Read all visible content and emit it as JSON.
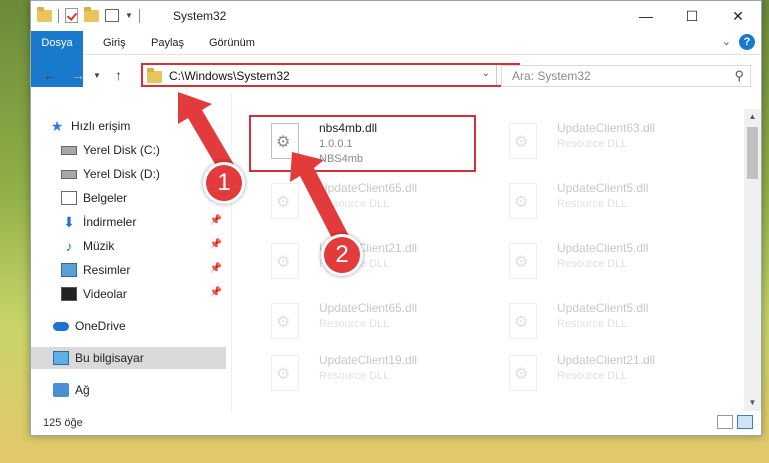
{
  "window": {
    "title": "System32",
    "controls": [
      "—",
      "☐",
      "✕"
    ]
  },
  "ribbon": {
    "tabs": [
      "Dosya",
      "Giriş",
      "Paylaş",
      "Görünüm"
    ]
  },
  "address": {
    "path": "C:\\Windows\\System32",
    "search_placeholder": "Ara: System32"
  },
  "sidebar": {
    "items": [
      {
        "label": "Hızlı erişim"
      },
      {
        "label": "Yerel Disk (C:)"
      },
      {
        "label": "Yerel Disk (D:)"
      },
      {
        "label": "Belgeler"
      },
      {
        "label": "İndirmeler"
      },
      {
        "label": "Müzik"
      },
      {
        "label": "Resimler"
      },
      {
        "label": "Videolar"
      },
      {
        "label": "OneDrive"
      },
      {
        "label": "Bu bilgisayar"
      },
      {
        "label": "Ağ"
      }
    ]
  },
  "files": [
    {
      "name": "nbs4mb.dll",
      "line2": "1.0.0.1",
      "line3": "NBS4mb"
    },
    {
      "name": "UpdateClient63.dll",
      "line2": "Resource DLL"
    },
    {
      "name": "UpdateClient65.dll",
      "line2": "Resource DLL"
    },
    {
      "name": "UpdateClient5.dll",
      "line2": "Resource DLL"
    },
    {
      "name": "UpdateClient21.dll",
      "line2": "Resource DLL"
    },
    {
      "name": "UpdateClient5.dll",
      "line2": "Resource DLL"
    },
    {
      "name": "UpdateClient65.dll",
      "line2": "Resource DLL"
    },
    {
      "name": "UpdateClient5.dll",
      "line2": "Resource DLL"
    },
    {
      "name": "UpdateClient19.dll",
      "line2": "Resource DLL"
    },
    {
      "name": "UpdateClient21.dll",
      "line2": "Resource DLL"
    }
  ],
  "status": {
    "count": "125 öğe"
  },
  "annotations": {
    "badge1": "1",
    "badge2": "2",
    "color": "#e23b3b"
  }
}
